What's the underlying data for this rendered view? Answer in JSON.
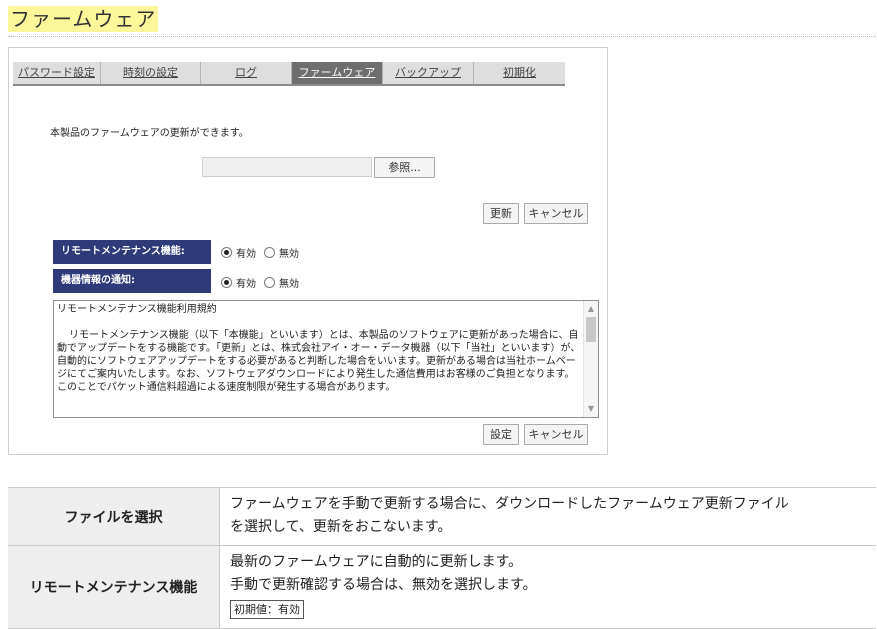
{
  "page": {
    "title": "ファームウェア"
  },
  "tabs": [
    {
      "label": "パスワード設定"
    },
    {
      "label": "時刻の設定"
    },
    {
      "label": "ログ"
    },
    {
      "label": "ファームウェア"
    },
    {
      "label": "バックアップ"
    },
    {
      "label": "初期化"
    }
  ],
  "firmware": {
    "description": "本製品のファームウェアの更新ができます。",
    "browse_label": "参照...",
    "update_label": "更新",
    "cancel_label": "キャンセル"
  },
  "settings": {
    "remote_label": "リモートメンテナンス機能:",
    "notify_label": "機器情報の通知:",
    "enabled_label": "有効",
    "disabled_label": "無効",
    "remote_value": "有効",
    "notify_value": "有効"
  },
  "terms": {
    "title": "リモートメンテナンス機能利用規約",
    "body": "リモートメンテナンス機能（以下「本機能」といいます）とは、本製品のソフトウェアに更新があった場合に、自動でアップデートをする機能です。「更新」とは、株式会社アイ・オー・データ機器（以下「当社」といいます）が、自動的にソフトウェアアップデートをする必要があると判断した場合をいいます。更新がある場合は当社ホームページにてご案内いたします。なお、ソフトウェアダウンロードにより発生した通信費用はお客様のご負担となります。このことでパケット通信料超過による速度制限が発生する場合があります。",
    "set_label": "設定",
    "cancel_label": "キャンセル"
  },
  "info_table": {
    "rows": [
      {
        "key": "ファイルを選択",
        "lines": [
          "ファームウェアを手動で更新する場合に、ダウンロードしたファームウェア更新ファイル",
          "を選択して、更新をおこないます。"
        ]
      },
      {
        "key": "リモートメンテナンス機能",
        "lines": [
          "最新のファームウェアに自動的に更新します。",
          "手動で更新確認する場合は、無効を選択します。"
        ],
        "badge": "初期値：有効"
      }
    ]
  }
}
